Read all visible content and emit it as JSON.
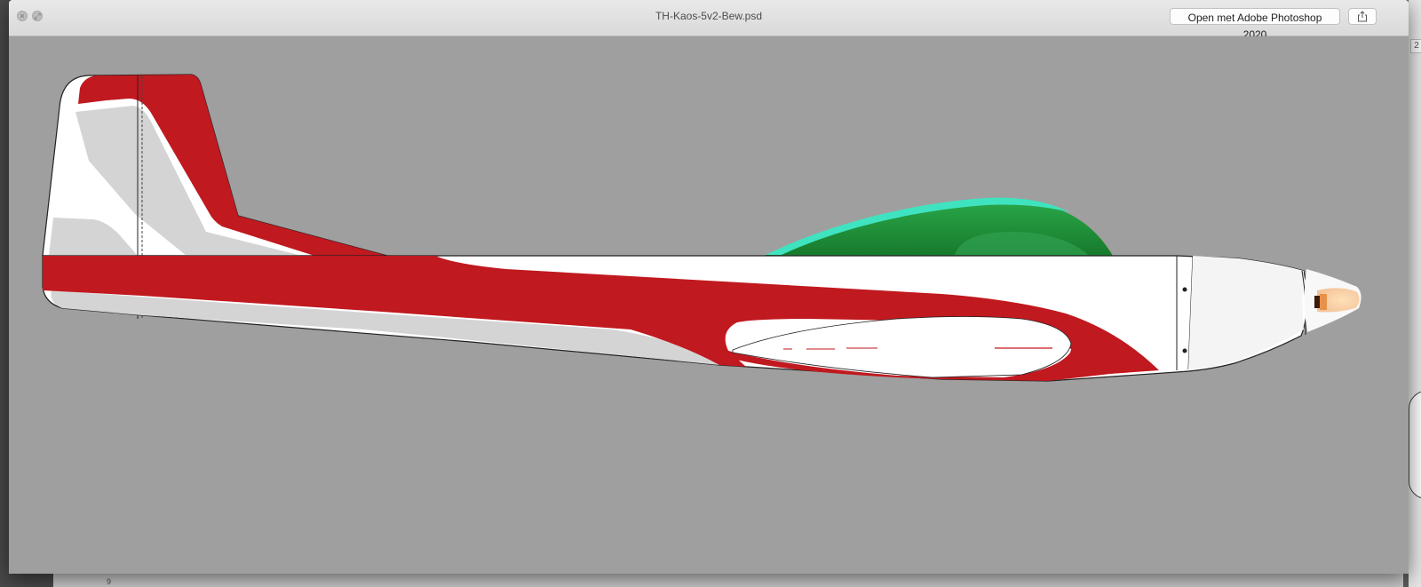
{
  "window": {
    "title": "TH-Kaos-5v2-Bew.psd",
    "open_with_label": "Open met Adobe Photoshop 2020",
    "close_glyph": "×",
    "fullscreen_glyph": "⤢"
  },
  "background_app": {
    "bottom_label": "9",
    "right_badge": "2"
  },
  "icons": {
    "close": "close-icon",
    "fullscreen": "fullscreen-icon",
    "share": "share-icon"
  },
  "colors": {
    "canvas": "#9f9f9f",
    "livery_red": "#c0191f",
    "canopy_green": "#1f8a36",
    "canopy_edge": "#35d6b8",
    "body_white": "#ffffff",
    "shadow_grey": "#d3d3d3"
  }
}
